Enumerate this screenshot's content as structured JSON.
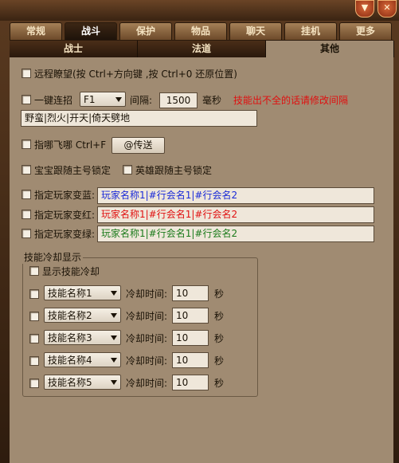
{
  "window": {
    "minimize_icon": "chevron-down-icon",
    "close_icon": "close-icon"
  },
  "tabs": [
    {
      "label": "常规"
    },
    {
      "label": "战斗"
    },
    {
      "label": "保护"
    },
    {
      "label": "物品"
    },
    {
      "label": "聊天"
    },
    {
      "label": "挂机"
    },
    {
      "label": "更多"
    }
  ],
  "active_tab": "战斗",
  "subtabs": [
    {
      "label": "战士"
    },
    {
      "label": "法道"
    },
    {
      "label": "其他"
    }
  ],
  "active_subtab": "其他",
  "options": {
    "remote_view": "远程瞭望(按 Ctrl+方向键 ,按 Ctrl+0 还原位置)",
    "combo_label": "一键连招",
    "combo_key": "F1",
    "interval_label": "间隔:",
    "interval_value": "1500",
    "interval_unit": "毫秒",
    "combo_hint": "技能出不全的话请修改间隔",
    "combo_skills": "野蛮|烈火|开天|倚天劈地",
    "fly_label": "指哪飞哪 Ctrl+F",
    "teleport_button": "@传送",
    "pet_follow": "宝宝跟随主号锁定",
    "hero_follow": "英雄跟随主号锁定",
    "blue_label": "指定玩家变蓝:",
    "blue_value": "玩家名称1|#行会名1|#行会名2",
    "red_label": "指定玩家变红:",
    "red_value": "玩家名称1|#行会名1|#行会名2",
    "green_label": "指定玩家变绿:",
    "green_value": "玩家名称1|#行会名1|#行会名2"
  },
  "cooldown": {
    "title": "技能冷却显示",
    "show_label": "显示技能冷却",
    "cd_label": "冷却时间:",
    "unit": "秒",
    "rows": [
      {
        "skill": "技能名称1",
        "value": "10"
      },
      {
        "skill": "技能名称2",
        "value": "10"
      },
      {
        "skill": "技能名称3",
        "value": "10"
      },
      {
        "skill": "技能名称4",
        "value": "10"
      },
      {
        "skill": "技能名称5",
        "value": "10"
      }
    ]
  },
  "colors": {
    "blue": "#1a2ad8",
    "red": "#e01010",
    "green": "#1a7a1a",
    "panel": "#a08b72"
  }
}
